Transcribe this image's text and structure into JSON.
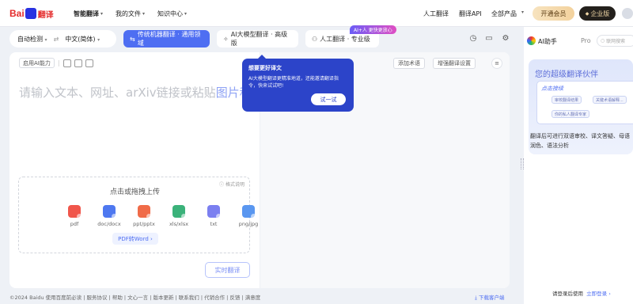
{
  "brand": {
    "logo_text_a": "Bai",
    "logo_text_b": "翻译"
  },
  "nav": {
    "left": [
      "智能翻译",
      "我的文件",
      "知识中心"
    ],
    "right": [
      "人工翻译",
      "翻译API",
      "全部产品"
    ],
    "vip_label": "开通会员",
    "enterprise_label": "企业版"
  },
  "lang": {
    "source": "自动检测",
    "target": "中文(简体)"
  },
  "modes": {
    "machine": "传统机器翻译 · 通用领域",
    "llm": "AI大模型翻译 · 高级版",
    "human": "人工翻译 · 专业级",
    "ai_tag": "AI+人 更快更放心"
  },
  "source_tools": {
    "ai_ability": "启用AI能力"
  },
  "target_tools": {
    "add_term": "添加术语",
    "enhance": "增强翻译设置"
  },
  "editor": {
    "placeholder_a": "请输入文本、网址、arXiv链接或粘贴",
    "placeholder_b": "图片秒翻",
    "translate_button": "实时翻译"
  },
  "upload": {
    "title": "点击或拖拽上传",
    "format_note": "格式说明",
    "types": [
      {
        "label": "pdf",
        "color": "#f0564b"
      },
      {
        "label": "doc/docx",
        "color": "#4e78f0"
      },
      {
        "label": "ppt/pptx",
        "color": "#f06b48"
      },
      {
        "label": "xls/xlsx",
        "color": "#3bb27a"
      },
      {
        "label": "txt",
        "color": "#7b7ff0"
      },
      {
        "label": "png/jpg",
        "color": "#5a97f0"
      }
    ],
    "pdf_to_word": "PDF转Word"
  },
  "popup": {
    "title": "想要更好译文",
    "body": "AI大模型翻译更精准地道，还能邀请翻译指令，快来试试吧!",
    "button": "试一试"
  },
  "assistant": {
    "name": "AI助手",
    "pro": "Pro",
    "search_placeholder": "联网搜索",
    "card_title": "您的超级翻译伙伴",
    "mock_tag": "点击接续",
    "mock_items": [
      "审校翻译结果",
      "关键术语解释...",
      "你的私人翻译专家"
    ],
    "description": "翻译后可进行双语审校、译文答疑、母语润色、语法分析",
    "login_prompt": "请登录后使用",
    "login_link": "立即登录"
  },
  "footer": {
    "text": "©2024 Baidu  使用百度前必读 | 服务协议 | 帮助 | 文心一言 | 版本更新 | 联系我们 | 代销合作 | 反馈 | 满意度",
    "download": "下载客户端"
  },
  "colors": {
    "accent": "#4e6ef2",
    "popup": "#2c44c9"
  }
}
